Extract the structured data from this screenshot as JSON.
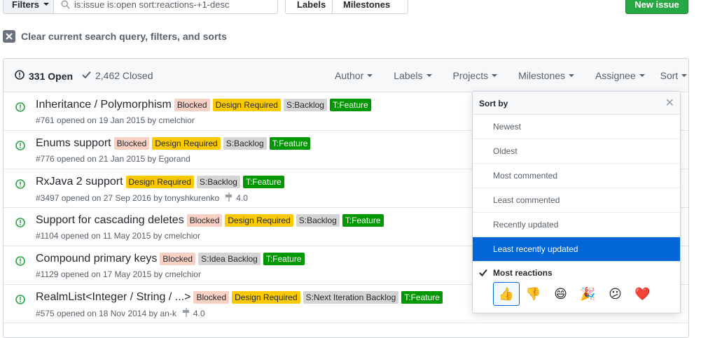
{
  "topbar": {
    "filters_label": "Filters",
    "search_value": "is:issue is:open sort:reactions-+1-desc",
    "labels_btn": "Labels",
    "milestones_btn": "Milestones",
    "new_issue_btn": "New issue"
  },
  "clear_filters": "Clear current search query, filters, and sorts",
  "header": {
    "open": "331 Open",
    "closed": "2,462 Closed",
    "menus": [
      "Author",
      "Labels",
      "Projects",
      "Milestones",
      "Assignee",
      "Sort"
    ]
  },
  "issues": [
    {
      "title": "Inheritance / Polymorphism",
      "meta": "#761 opened on 19 Jan 2015 by cmelchior",
      "milestone": "",
      "labels": [
        {
          "text": "Blocked",
          "bg": "#f9d0c4",
          "fg": "#24292e"
        },
        {
          "text": "Design Required",
          "bg": "#fbca04",
          "fg": "#24292e"
        },
        {
          "text": "S:Backlog",
          "bg": "#d4d4d4",
          "fg": "#24292e"
        },
        {
          "text": "T:Feature",
          "bg": "#009800",
          "fg": "#ffffff"
        }
      ]
    },
    {
      "title": "Enums support",
      "meta": "#776 opened on 21 Jan 2015 by Egorand",
      "milestone": "",
      "labels": [
        {
          "text": "Blocked",
          "bg": "#f9d0c4",
          "fg": "#24292e"
        },
        {
          "text": "Design Required",
          "bg": "#fbca04",
          "fg": "#24292e"
        },
        {
          "text": "S:Backlog",
          "bg": "#d4d4d4",
          "fg": "#24292e"
        },
        {
          "text": "T:Feature",
          "bg": "#009800",
          "fg": "#ffffff"
        }
      ]
    },
    {
      "title": "RxJava 2 support",
      "meta": "#3497 opened on 27 Sep 2016 by tonyshkurenko",
      "milestone": "4.0",
      "labels": [
        {
          "text": "Design Required",
          "bg": "#fbca04",
          "fg": "#24292e"
        },
        {
          "text": "S:Backlog",
          "bg": "#d4d4d4",
          "fg": "#24292e"
        },
        {
          "text": "T:Feature",
          "bg": "#009800",
          "fg": "#ffffff"
        }
      ]
    },
    {
      "title": "Support for cascading deletes",
      "meta": "#1104 opened on 11 May 2015 by cmelchior",
      "milestone": "",
      "labels": [
        {
          "text": "Blocked",
          "bg": "#f9d0c4",
          "fg": "#24292e"
        },
        {
          "text": "Design Required",
          "bg": "#fbca04",
          "fg": "#24292e"
        },
        {
          "text": "S:Backlog",
          "bg": "#d4d4d4",
          "fg": "#24292e"
        },
        {
          "text": "T:Feature",
          "bg": "#009800",
          "fg": "#ffffff"
        }
      ]
    },
    {
      "title": "Compound primary keys",
      "meta": "#1129 opened on 17 May 2015 by cmelchior",
      "milestone": "",
      "labels": [
        {
          "text": "Blocked",
          "bg": "#f9d0c4",
          "fg": "#24292e"
        },
        {
          "text": "S:Idea Backlog",
          "bg": "#d4d4d4",
          "fg": "#24292e"
        },
        {
          "text": "T:Feature",
          "bg": "#009800",
          "fg": "#ffffff"
        }
      ]
    },
    {
      "title": "RealmList<Integer / String / ...>",
      "meta": "#575 opened on 18 Nov 2014 by an-k",
      "milestone": "4.0",
      "labels": [
        {
          "text": "Blocked",
          "bg": "#f9d0c4",
          "fg": "#24292e"
        },
        {
          "text": "Design Required",
          "bg": "#fbca04",
          "fg": "#24292e"
        },
        {
          "text": "S:Next Iteration Backlog",
          "bg": "#d4d4d4",
          "fg": "#24292e"
        },
        {
          "text": "T:Feature",
          "bg": "#009800",
          "fg": "#ffffff"
        }
      ]
    }
  ],
  "sort_menu": {
    "title": "Sort by",
    "options": [
      "Newest",
      "Oldest",
      "Most commented",
      "Least commented",
      "Recently updated",
      "Least recently updated"
    ],
    "selected_index": 5,
    "reactions_label": "Most reactions",
    "reaction_emojis": [
      "👍",
      "👎",
      "😄",
      "🎉",
      "😕",
      "❤️"
    ],
    "active_reaction_index": 0
  },
  "colors": {
    "accent": "#0366d6",
    "new_issue_green": "#28a745",
    "open_icon": "#28a745"
  }
}
